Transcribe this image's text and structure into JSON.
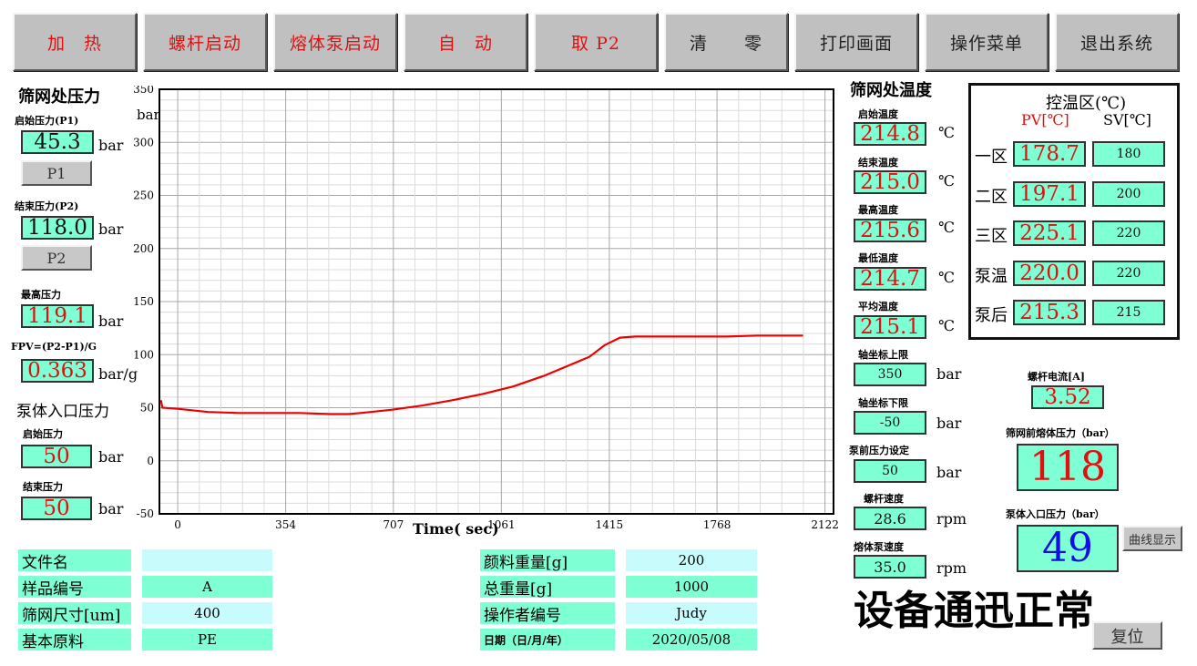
{
  "toolbar": {
    "heat": "加　热",
    "screw_start": "螺杆启动",
    "melt_pump_start": "熔体泵启动",
    "auto": "自　动",
    "take_p2": "取 P2",
    "clear": "清　　零",
    "print_screen": "打印画面",
    "operation_menu": "操作菜单",
    "exit_system": "退出系统"
  },
  "left": {
    "screen_pressure_title": "筛网处压力",
    "start_pressure_label": "启始压力(P1)",
    "start_pressure_value": "45.3",
    "p1_button": "P1",
    "end_pressure_label": "结束压力(P2)",
    "end_pressure_value": "118.0",
    "p2_button": "P2",
    "max_pressure_label": "最高压力",
    "max_pressure_value": "119.1",
    "fpv_label": "FPV=(P2-P1)/G",
    "fpv_value": "0.363",
    "fpv_unit": "bar/g",
    "unit_bar": "bar",
    "pump_inlet_title": "泵体入口压力",
    "pump_start_label": "启始压力",
    "pump_start_value": "50",
    "pump_end_label": "结束压力",
    "pump_end_value": "50"
  },
  "chart_data": {
    "type": "line",
    "ylabel": "bar",
    "xlabel": "Time( sec)",
    "ylim": [
      -50,
      350
    ],
    "xlim": [
      -60,
      2150
    ],
    "y_ticks": [
      -50,
      0,
      50,
      100,
      150,
      200,
      250,
      300,
      350
    ],
    "x_ticks": [
      0,
      354,
      707,
      1061,
      1415,
      1768,
      2122
    ],
    "series": [
      {
        "color": "#ee0000",
        "points": [
          [
            -55,
            57
          ],
          [
            -50,
            50
          ],
          [
            0,
            49
          ],
          [
            100,
            46
          ],
          [
            200,
            45
          ],
          [
            300,
            45
          ],
          [
            400,
            45
          ],
          [
            500,
            44
          ],
          [
            560,
            44
          ],
          [
            600,
            45
          ],
          [
            700,
            48
          ],
          [
            800,
            52
          ],
          [
            900,
            57
          ],
          [
            1000,
            63
          ],
          [
            1100,
            70
          ],
          [
            1200,
            80
          ],
          [
            1300,
            92
          ],
          [
            1350,
            98
          ],
          [
            1400,
            109
          ],
          [
            1450,
            116
          ],
          [
            1500,
            117
          ],
          [
            1600,
            117
          ],
          [
            1700,
            117
          ],
          [
            1800,
            117
          ],
          [
            1900,
            118
          ],
          [
            2000,
            118
          ],
          [
            2050,
            118
          ]
        ]
      }
    ]
  },
  "temp": {
    "title": "筛网处温度",
    "unit_c": "℃",
    "start_label": "启始温度",
    "start_value": "214.8",
    "end_label": "结束温度",
    "end_value": "215.0",
    "max_label": "最高温度",
    "max_value": "215.6",
    "min_label": "最低温度",
    "min_value": "214.7",
    "avg_label": "平均温度",
    "avg_value": "215.1"
  },
  "axis_settings": {
    "upper_label": "轴坐标上限",
    "upper_value": "350",
    "lower_label": "轴坐标下限",
    "lower_value": "-50",
    "pump_front_label": "泵前压力设定",
    "pump_front_value": "50",
    "screw_speed_label": "螺杆速度",
    "screw_speed_value": "28.6",
    "pump_speed_label": "熔体泵速度",
    "pump_speed_value": "35.0",
    "unit_bar": "bar",
    "unit_rpm": "rpm"
  },
  "zones": {
    "title": "控温区(℃)",
    "pv_header": "PV[℃]",
    "sv_header": "SV[℃]",
    "rows": [
      {
        "name": "一区",
        "pv": "178.7",
        "sv": "180"
      },
      {
        "name": "二区",
        "pv": "197.1",
        "sv": "200"
      },
      {
        "name": "三区",
        "pv": "225.1",
        "sv": "220"
      },
      {
        "name": "泵温",
        "pv": "220.0",
        "sv": "220"
      },
      {
        "name": "泵后",
        "pv": "215.3",
        "sv": "215"
      }
    ]
  },
  "right": {
    "screw_current_label": "螺杆电流[A]",
    "screw_current_value": "3.52",
    "screen_front_pressure_label": "筛网前熔体压力（bar）",
    "screen_front_pressure_value": "118",
    "pump_inlet_pressure_label": "泵体入口压力（bar）",
    "pump_inlet_pressure_value": "49",
    "curve_display_button": "曲线显示",
    "status_text": "设备通迅正常",
    "reset_button": "复位"
  },
  "bottom": {
    "left": [
      {
        "label": "文件名",
        "value": ""
      },
      {
        "label": "样品编号",
        "value": "A"
      },
      {
        "label": "筛网尺寸[um]",
        "value": "400"
      },
      {
        "label": "基本原料",
        "value": "PE"
      }
    ],
    "right": [
      {
        "label": "颜料重量[g]",
        "value": "200"
      },
      {
        "label": "总重量[g]",
        "value": "1000"
      },
      {
        "label": "操作者编号",
        "value": "Judy"
      },
      {
        "label": "日期（日/月/年）",
        "value": "2020/05/08"
      }
    ]
  },
  "colors": {
    "value_bg": "#7fffd4",
    "value_red": "#e01010",
    "value_blue": "#1010e0",
    "info_bg": "#c8fcfc",
    "button_gray": "#c0c0c0"
  }
}
